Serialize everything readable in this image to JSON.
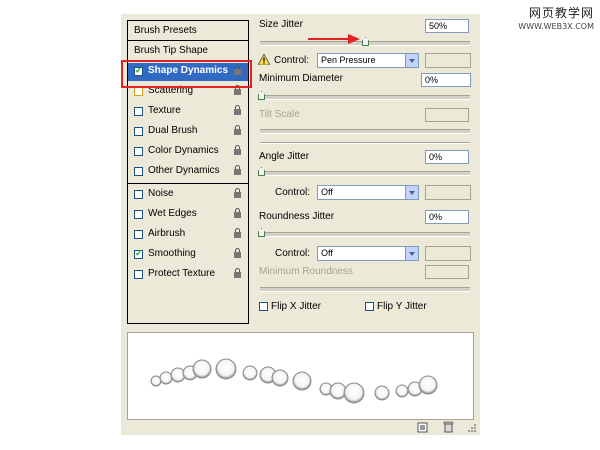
{
  "watermark": {
    "title": "网页教学网",
    "url": "WWW.WEB3X.COM"
  },
  "left_panel": {
    "brush_presets": "Brush Presets",
    "brush_tip_shape": "Brush Tip Shape",
    "items": [
      {
        "label": "Shape Dynamics",
        "checked": true,
        "selected": true
      },
      {
        "label": "Scattering",
        "checked": false
      },
      {
        "label": "Texture",
        "checked": false
      },
      {
        "label": "Dual Brush",
        "checked": false
      },
      {
        "label": "Color Dynamics",
        "checked": false
      },
      {
        "label": "Other Dynamics",
        "checked": false
      },
      {
        "label": "Noise",
        "checked": false
      },
      {
        "label": "Wet Edges",
        "checked": false
      },
      {
        "label": "Airbrush",
        "checked": false
      },
      {
        "label": "Smoothing",
        "checked": true
      },
      {
        "label": "Protect Texture",
        "checked": false
      }
    ]
  },
  "options": {
    "size_jitter_label": "Size Jitter",
    "size_jitter_value": "50%",
    "size_jitter_fraction": 0.5,
    "control_label": "Control:",
    "size_control_value": "Pen Pressure",
    "min_diameter_label": "Minimum Diameter",
    "min_diameter_value": "0%",
    "tilt_scale_label": "Tilt Scale",
    "angle_jitter_label": "Angle Jitter",
    "angle_jitter_value": "0%",
    "angle_control_value": "Off",
    "roundness_jitter_label": "Roundness Jitter",
    "roundness_jitter_value": "0%",
    "roundness_control_value": "Off",
    "min_roundness_label": "Minimum Roundness",
    "flip_x_label": "Flip X Jitter",
    "flip_y_label": "Flip Y Jitter"
  },
  "colors": {
    "accent_red": "#e52222",
    "selected_bg": "#316ac5",
    "panel_bg": "#ece9d8"
  }
}
